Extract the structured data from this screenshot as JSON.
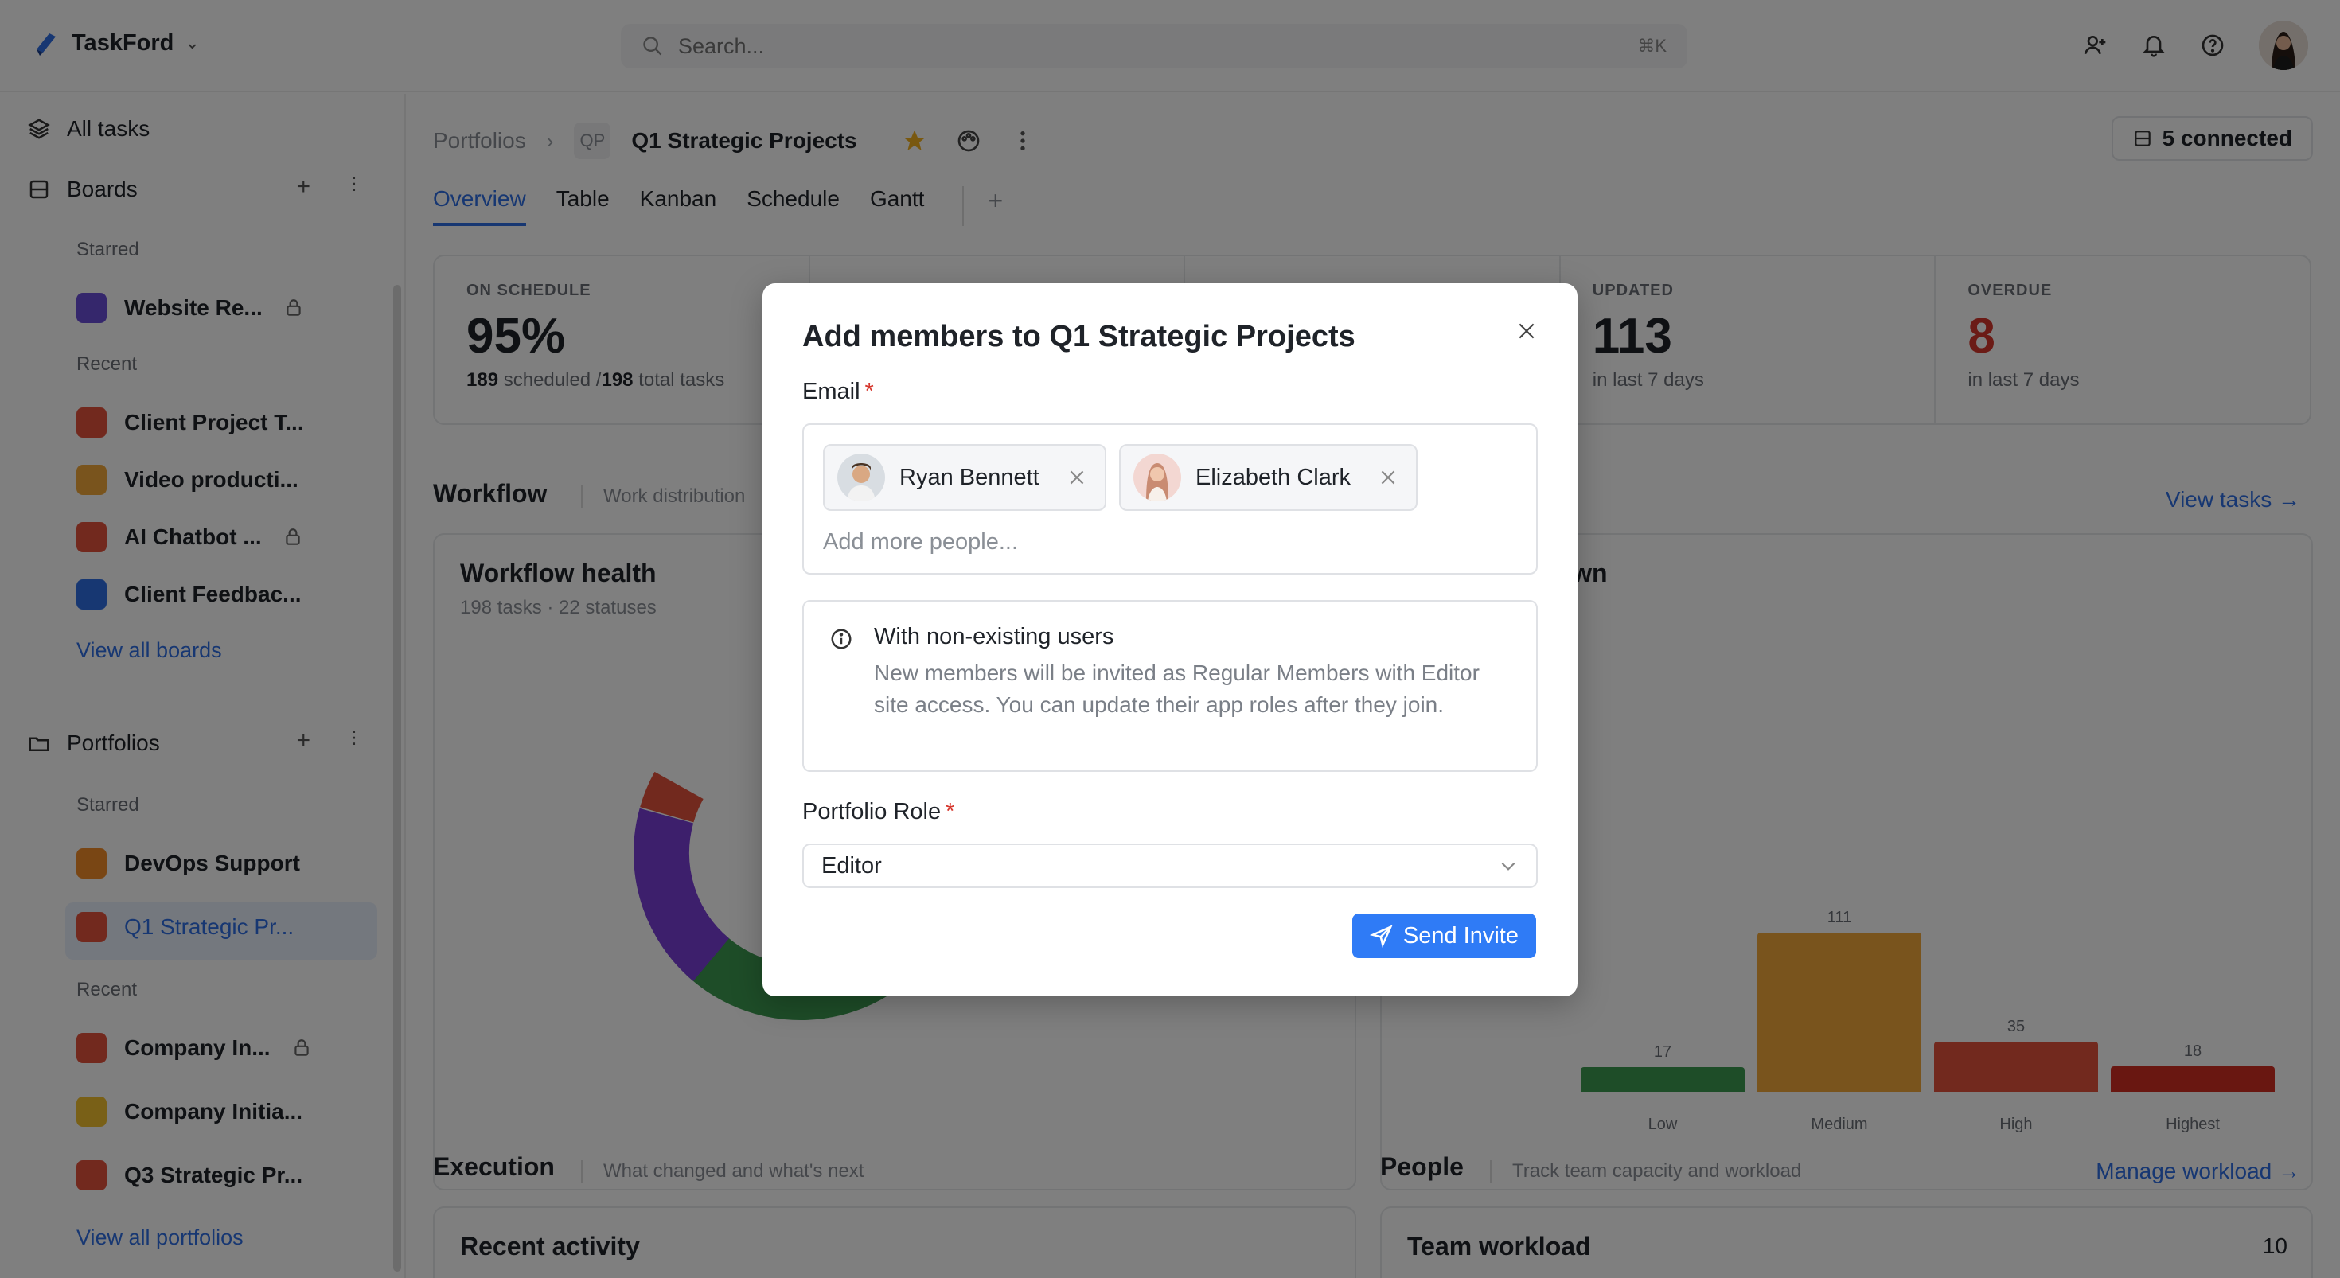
{
  "app": {
    "name": "TaskFord"
  },
  "search": {
    "placeholder": "Search...",
    "shortcut": "⌘K"
  },
  "sidebar": {
    "all_tasks": "All tasks",
    "boards_label": "Boards",
    "boards_starred_label": "Starred",
    "boards_starred": [
      {
        "label": "Website Re...",
        "locked": true,
        "color": "#6b4fd8"
      }
    ],
    "boards_recent_label": "Recent",
    "boards_recent": [
      {
        "label": "Client Project T...",
        "color": "#e5533d"
      },
      {
        "label": "Video producti...",
        "color": "#f2a93b"
      },
      {
        "label": "AI Chatbot ...",
        "color": "#e5533d"
      },
      {
        "label": "Client Feedbac...",
        "color": "#2f6fe4"
      }
    ],
    "view_all_boards": "View all boards",
    "portfolios_label": "Portfolios",
    "portfolios_starred_label": "Starred",
    "portfolios_starred": [
      {
        "label": "DevOps Support",
        "color": "#f28c28"
      },
      {
        "label": "Q1 Strategic Pr...",
        "color": "#e5533d"
      }
    ],
    "portfolios_recent_label": "Recent",
    "portfolios_recent": [
      {
        "label": "Company In...",
        "color": "#e5533d"
      },
      {
        "label": "Company Initia...",
        "color": "#f2c12e"
      },
      {
        "label": "Q3 Strategic Pr...",
        "color": "#e5533d"
      }
    ],
    "view_all_portfolios": "View all portfolios"
  },
  "breadcrumb": {
    "root": "Portfolios",
    "badge": "QP",
    "title": "Q1 Strategic Projects"
  },
  "connected": "5 connected",
  "tabs": [
    "Overview",
    "Table",
    "Kanban",
    "Schedule",
    "Gantt"
  ],
  "stats": [
    {
      "label": "ON SCHEDULE",
      "value": "95%",
      "sub_a": "189",
      "sub_b": " scheduled /",
      "sub_c": "198",
      "sub_d": " total tasks"
    },
    {
      "label": "UPDATED",
      "value": "113",
      "sub": "in last 7 days"
    },
    {
      "label": "OVERDUE",
      "value": "8",
      "sub": "in last 7 days"
    }
  ],
  "workflow": {
    "title": "Workflow",
    "desc": "Work distribution",
    "card_title": "Workflow health",
    "card_sub": "198 tasks · 22 statuses"
  },
  "breakdown": {
    "title": "down",
    "link": "View tasks →"
  },
  "chart_data": {
    "type": "bar",
    "categories": [
      "Low",
      "Medium",
      "High",
      "Highest"
    ],
    "values": [
      17,
      111,
      35,
      18
    ],
    "colors": [
      "#3d9a50",
      "#f2a93b",
      "#e5533d",
      "#d22f23"
    ]
  },
  "execution": {
    "title": "Execution",
    "desc": "What changed and what's next",
    "card_title": "Recent activity"
  },
  "people": {
    "title": "People",
    "desc": "Track team capacity and workload",
    "link": "Manage workload →",
    "card_title": "Team workload",
    "count": "10"
  },
  "modal": {
    "title": "Add members to Q1 Strategic Projects",
    "email_label": "Email",
    "chips": [
      {
        "name": "Ryan Bennett"
      },
      {
        "name": "Elizabeth Clark"
      }
    ],
    "email_placeholder": "Add more people...",
    "info_title": "With non-existing users",
    "info_text": "New members will be invited as Regular Members with Editor site access. You can update their app roles after they join.",
    "role_label": "Portfolio Role",
    "role_value": "Editor",
    "send_label": "Send Invite"
  }
}
